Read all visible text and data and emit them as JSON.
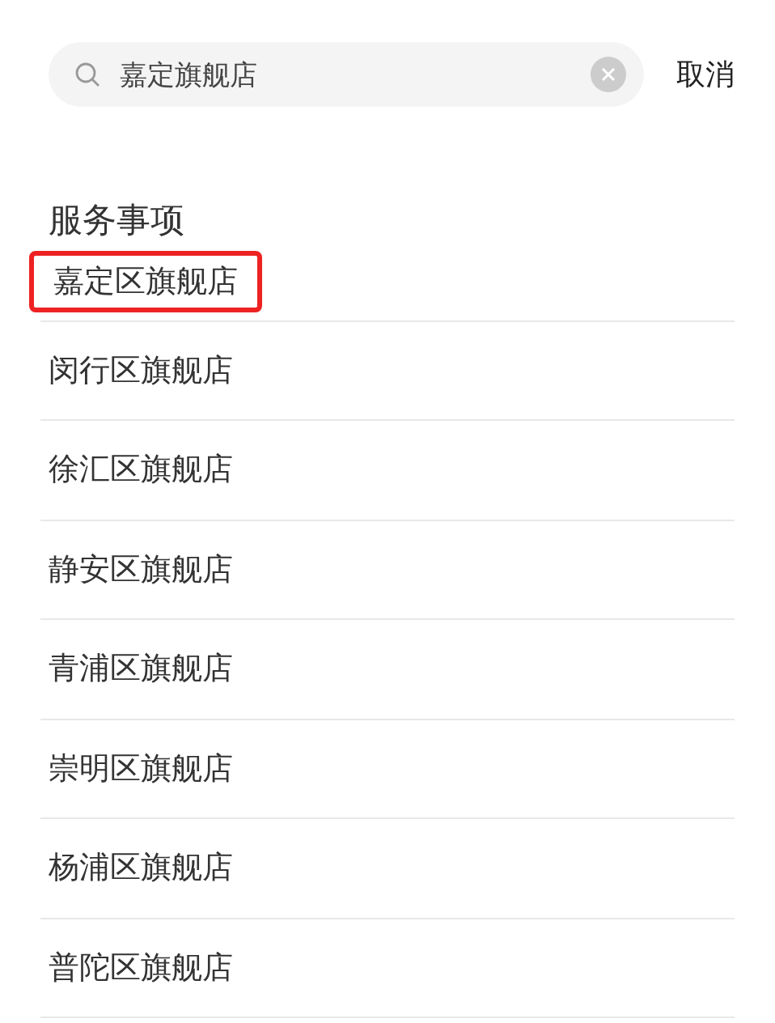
{
  "search": {
    "value": "嘉定旗舰店"
  },
  "cancel": "取消",
  "section": {
    "title": "服务事项",
    "items": [
      {
        "label": "嘉定区旗舰店",
        "highlighted": true
      },
      {
        "label": "闵行区旗舰店",
        "highlighted": false
      },
      {
        "label": "徐汇区旗舰店",
        "highlighted": false
      },
      {
        "label": "静安区旗舰店",
        "highlighted": false
      },
      {
        "label": "青浦区旗舰店",
        "highlighted": false
      },
      {
        "label": "崇明区旗舰店",
        "highlighted": false
      },
      {
        "label": "杨浦区旗舰店",
        "highlighted": false
      },
      {
        "label": "普陀区旗舰店",
        "highlighted": false
      }
    ]
  }
}
